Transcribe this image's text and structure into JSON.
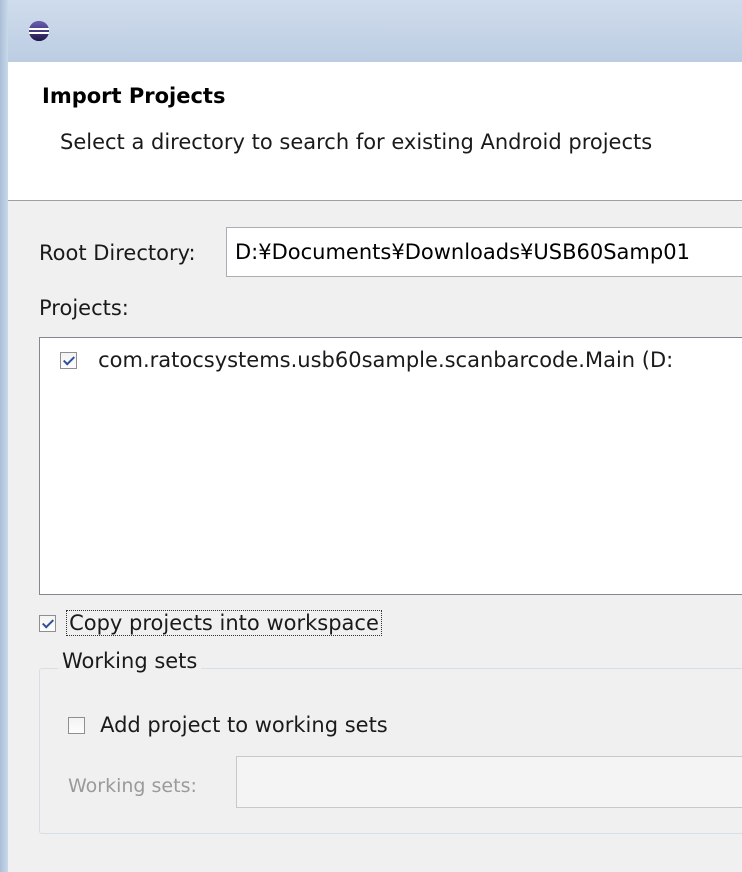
{
  "dialog": {
    "title": "Import Projects",
    "description": "Select a directory to search for existing Android projects"
  },
  "root": {
    "label": "Root Directory:",
    "value": "D:¥Documents¥Downloads¥USB60Samp01"
  },
  "projects": {
    "label": "Projects:",
    "items": [
      {
        "name": "com.ratocsystems.usb60sample.scanbarcode.Main (D:",
        "checked": true
      }
    ]
  },
  "copy": {
    "label": "Copy projects into workspace",
    "checked": true
  },
  "working_sets": {
    "legend": "Working sets",
    "add_label": "Add project to working sets",
    "add_checked": false,
    "sets_label": "Working sets:",
    "sets_value": ""
  },
  "colors": {
    "titlebar": "#bccde3",
    "banner_bg": "#ffffff",
    "panel_bg": "#f0f0f0",
    "check_mark": "#304f9b"
  }
}
